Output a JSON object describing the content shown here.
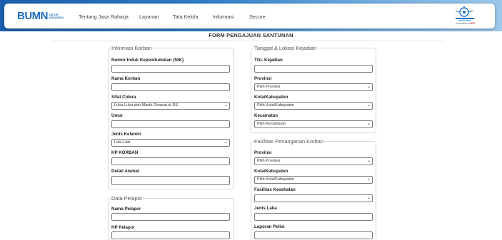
{
  "header": {
    "logo_text": "BUMN",
    "logo_sub_1": "UNTUK",
    "logo_sub_2": "INDONESIA",
    "nav": [
      "Tentang Jasa Raharja",
      "Layanan",
      "Tata Kelola",
      "Informasi",
      "Secure"
    ],
    "brand_tagline_prefix": "A member of",
    "brand_tagline_group": "IFG"
  },
  "page_title": "FORM PENGAJUAN SANTUNAN",
  "korban": {
    "legend": "Informasi Korban",
    "nik_label": "Nomor Induk Kependudukan (NIK)",
    "nama_label": "Nama Korban",
    "sifat_label": "Sifat Cidera",
    "sifat_value": "Luka-Luka dan Masih Dirawat di RS",
    "umur_label": "Umur",
    "jk_label": "Jenis Kelamin",
    "jk_value": "Laki-Laki",
    "hp_label": "HP KORBAN",
    "alamat_label": "Detail Alamat"
  },
  "pelapor": {
    "legend": "Data Pelapor",
    "nama_label": "Nama Pelapor",
    "hp_label": "HP Pelapor"
  },
  "kejadian": {
    "legend": "Tanggal & Lokasi Kejadian",
    "tgl_label": "TGL Kejadian",
    "prov_label": "Provinsi",
    "prov_value": "Pilih Provinsi",
    "kota_label": "Kota/Kabupaten",
    "kota_value": "Pilih Kota/Kabupaten",
    "kec_label": "Kecamatan",
    "kec_value": "Pilih Kecamatan"
  },
  "fasilitas": {
    "legend": "Fasilitas Penanganan Korban",
    "prov_label": "Provinsi",
    "prov_value": "Pilih Provinsi",
    "kota_label": "Kota/Kabupaten",
    "kota_value": "Pilih Kota/Kabupaten",
    "faskes_label": "Fasilitas Kesehatan",
    "faskes_value": "",
    "laka_label": "Jenis Laka",
    "polisi_label": "Laporan Polisi"
  },
  "icons": {
    "dropdown": "chevron-down-icon",
    "resize": "resize-grip-icon"
  },
  "colors": {
    "brand_blue": "#1c6fc0",
    "ifg_red": "#c8102e"
  }
}
